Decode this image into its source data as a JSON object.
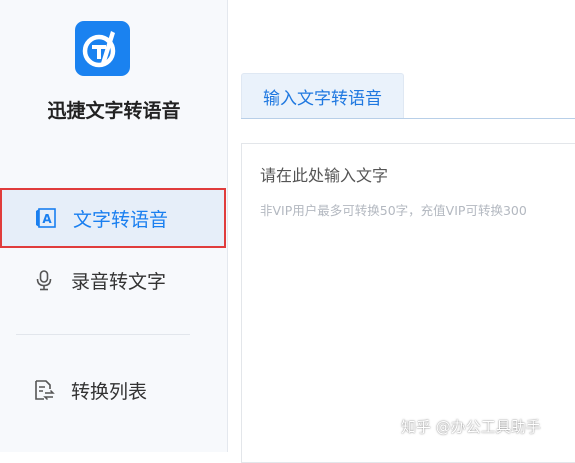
{
  "app": {
    "name": "迅捷文字转语音"
  },
  "sidebar": {
    "items": [
      {
        "label": "文字转语音",
        "icon": "text-a-icon",
        "active": true
      },
      {
        "label": "录音转文字",
        "icon": "microphone-icon",
        "active": false
      },
      {
        "label": "转换列表",
        "icon": "convert-list-icon",
        "active": false
      }
    ]
  },
  "main": {
    "tabs": [
      {
        "label": "输入文字转语音",
        "active": true
      }
    ],
    "editor": {
      "placeholder": "请在此处输入文字",
      "hint": "非VIP用户最多可转换50字，充值VIP可转换300"
    }
  },
  "watermark": "知乎 @办公工具助手",
  "colors": {
    "accent": "#1a7ff0",
    "logo_bg": "#1a82f0",
    "sidebar_bg": "#f7f9fc",
    "active_item_bg": "#e6eef9",
    "highlight_border": "#e03c3c"
  }
}
